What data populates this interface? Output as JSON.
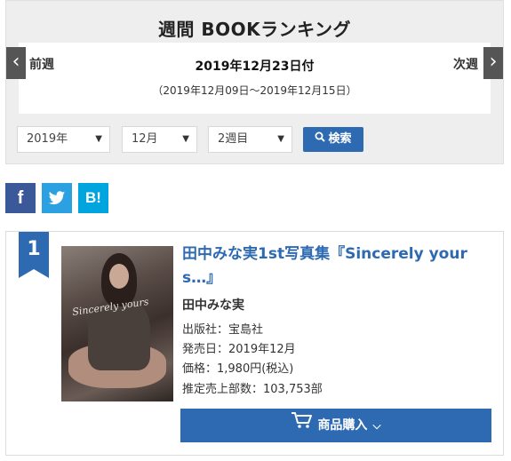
{
  "header": {
    "title": "週間 BOOKランキング",
    "date_main": "2019年12月23日付",
    "date_range": "（2019年12月09日〜2019年12月15日）",
    "prev_label": "前週",
    "next_label": "次週",
    "prev_arrow": "‹",
    "next_arrow": "›"
  },
  "filters": {
    "year": "2019年",
    "month": "12月",
    "week": "2週目",
    "search_label": "検索"
  },
  "share": {
    "facebook": "f",
    "twitter": "t",
    "hatena": "B!"
  },
  "item": {
    "rank": "1",
    "title": "田中みな実1st写真集『Sincerely yours…』",
    "title_display": "田中みな実1st写真集『Sincerely your s…』",
    "author": "田中みな実",
    "publisher": "出版社：宝島社",
    "release": "発売日：2019年12月",
    "price": "価格：1,980円(税込)",
    "sales": "推定売上部数：103,753部",
    "buy_label": "商品購入"
  },
  "colors": {
    "accent": "#2d6ab2",
    "facebook": "#3b5998",
    "twitter": "#2ba1e2",
    "hatena": "#00a4de",
    "header_bg": "#eeeeee",
    "nav_arrow_bg": "#555555"
  }
}
